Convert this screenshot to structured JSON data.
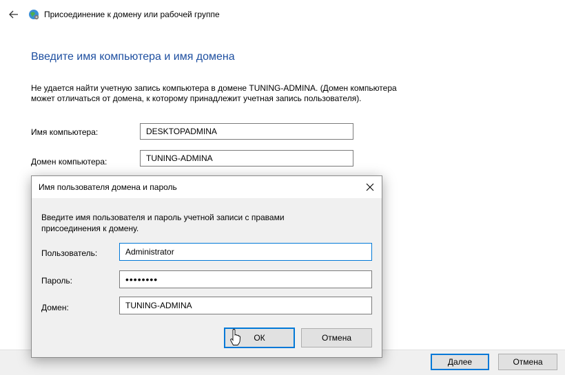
{
  "window": {
    "title": "Присоединение к домену или рабочей группе"
  },
  "page": {
    "heading": "Введите имя компьютера и имя домена",
    "message": "Не удается найти учетную запись компьютера в домене TUNING-ADMINA. (Домен компьютера может отличаться от домена, к которому принадлежит учетная запись пользователя).",
    "computer_name_label": "Имя компьютера:",
    "computer_name_value": "DESKTOPADMINA",
    "computer_domain_label": "Домен компьютера:",
    "computer_domain_value": "TUNING-ADMINA"
  },
  "footer": {
    "next_label": "Далее",
    "cancel_label": "Отмена"
  },
  "dialog": {
    "title": "Имя пользователя домена и пароль",
    "message": "Введите имя пользователя и пароль учетной записи с правами присоединения к домену.",
    "user_label": "Пользователь:",
    "user_value": "Administrator",
    "password_label": "Пароль:",
    "password_value": "••••••••",
    "domain_label": "Домен:",
    "domain_value": "TUNING-ADMINA",
    "ok_label": "ОК",
    "cancel_label": "Отмена"
  },
  "colors": {
    "heading": "#1e4fa0",
    "focus_border": "#0078d7",
    "dialog_bg": "#f0f0f0"
  },
  "icons": {
    "back": "back-arrow-icon",
    "wizard": "network-globe-icon",
    "close": "close-icon",
    "cursor": "mouse-pointer-icon"
  }
}
